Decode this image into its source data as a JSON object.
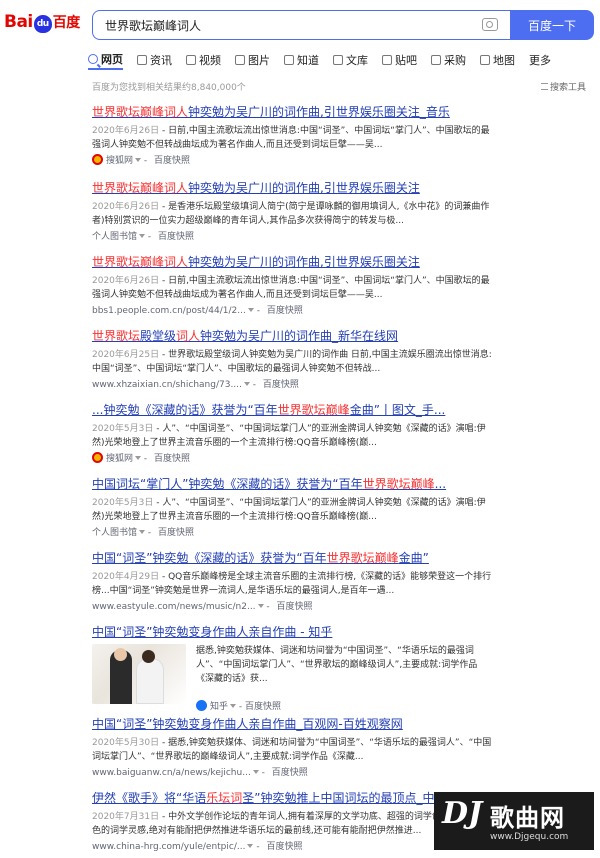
{
  "header": {
    "logo_bai": "Bai",
    "logo_du": "百度",
    "search_value": "世界歌坛巅峰词人",
    "search_button": "百度一下"
  },
  "tabs": [
    {
      "label": "网页",
      "active": true
    },
    {
      "label": "资讯"
    },
    {
      "label": "视频"
    },
    {
      "label": "图片"
    },
    {
      "label": "知道"
    },
    {
      "label": "文库"
    },
    {
      "label": "贴吧"
    },
    {
      "label": "采购"
    },
    {
      "label": "地图"
    },
    {
      "label": "更多"
    }
  ],
  "stats": {
    "text": "百度为您找到相关结果约8,840,000个",
    "tools": "搜索工具"
  },
  "results": [
    {
      "title": "世界歌坛巅峰词人钟奕勉为吴广川的词作曲,引世界娱乐圈关注_音乐",
      "date": "2020年6月26日",
      "abstract": " - 日前,中国主流歌坛流出惊世消息:中国“词圣”、中国词坛“掌门人”、中国歌坛的最强词人钟奕勉不但转战曲坛成为著名作曲人,而且还受到词坛巨擘——吴...",
      "source": "搜狐网",
      "snap": "百度快照"
    },
    {
      "title": "世界歌坛巅峰词人钟奕勉为吴广川的词作曲,引世界娱乐圈关注",
      "date": "2020年6月26日",
      "abstract": " - 是香港乐坛殿堂级填词人简宁(简宁是谭咏麟的御用填词人,《水中花》的词兼曲作者)特别赏识的一位实力超级巅峰的青年词人,其作品多次获得简宁的转发与极...",
      "source": "个人图书馆",
      "snap": "百度快照"
    },
    {
      "title": "世界歌坛巅峰词人钟奕勉为吴广川的词作曲,引世界娱乐圈关注",
      "date": "2020年6月26日",
      "abstract": " - 日前,中国主流歌坛流出惊世消息:中国“词圣”、中国词坛“掌门人”、中国歌坛的最强词人钟奕勉不但转战曲坛成为著名作曲人,而且还受到词坛巨擘——吴...",
      "source": "bbs1.people.com.cn/post/44/1/2...",
      "snap": "百度快照"
    },
    {
      "title": "世界歌坛殿堂级词人钟奕勉为吴广川的词作曲_新华在线网",
      "date": "2020年6月25日",
      "abstract": " - 世界歌坛殿堂级词人钟奕勉为吴广川的词作曲 日前,中国主流娱乐圈流出惊世消息:中国“词圣”、中国词坛“掌门人”、中国歌坛的最强词人钟奕勉不但转战...",
      "source": "www.xhzaixian.cn/shichang/73....",
      "snap": "百度快照"
    },
    {
      "title": "...钟奕勉《深藏的话》获誉为“百年世界歌坛巅峰金曲”丨图文_手...",
      "date": "2020年5月3日",
      "abstract": " - 人”、“中国词圣”、“中国词坛掌门人”的亚洲金牌词人钟奕勉《深藏的话》演唱:伊然)光荣地登上了世界主流音乐圈的一个主流排行榜:QQ音乐巅峰榜(巅...",
      "source": "搜狐网",
      "snap": "百度快照"
    },
    {
      "title": "中国词坛“掌门人”钟奕勉《深藏的话》获誉为“百年世界歌坛巅峰...",
      "date": "2020年5月3日",
      "abstract": " - 人”、“中国词圣”、“中国词坛掌门人”的亚洲金牌词人钟奕勉《深藏的话》演唱:伊然)光荣地登上了世界主流音乐圈的一个主流排行榜:QQ音乐巅峰榜(巅...",
      "source": "个人图书馆",
      "snap": "百度快照"
    },
    {
      "title": "中国“词圣”钟奕勉《深藏的话》获誉为“百年世界歌坛巅峰金曲”",
      "date": "2020年4月29日",
      "abstract": " - QQ音乐巅峰榜是全球主流音乐圈的主流排行榜,《深藏的话》能够荣登这一个排行榜...中国“词圣”钟奕勉是世界一流词人,是华语乐坛的最强词人,是百年一遇...",
      "source": "www.eastyule.com/news/music/n2...",
      "snap": "百度快照"
    },
    {
      "title": "中国“词圣”钟奕勉变身作曲人亲自作曲 - 知乎",
      "abstract": "据悉,钟奕勉获媒体、词迷和坊间誉为“中国词圣”、“华语乐坛的最强词人”、“中国词坛掌门人”、“世界歌坛的巅峰级词人”,主要成就:词学作品《深藏的话》获...",
      "source": "知乎",
      "snap": "百度快照"
    },
    {
      "title": "中国“词圣”钟奕勉变身作曲人亲自作曲_百观网-百姓观察网",
      "date": "2020年5月30日",
      "abstract": " - 据悉,钟奕勉获媒体、词迷和坊间誉为“中国词圣”、“华语乐坛的最强词人”、“中国词坛掌门人”、“世界歌坛的巅峰级词人”,主要成就:词学作品《深藏...",
      "source": "www.baiguanw.cn/a/news/kejichu...",
      "snap": "百度快照"
    },
    {
      "title": "伊然《歌手》将“华语乐坛词圣”钟奕勉推上中国词坛的最顶点_中国...",
      "date": "2020年7月31日",
      "abstract": " - 中外文学创作论坛的青年词人,拥有着深厚的文学功底、超强的词学创作能力、出色的词学灵感,绝对有能耐把伊然推进华语乐坛的最前线,还可能有能耐把伊然推进...",
      "source": "www.china-hrg.com/yule/entpic/...",
      "snap": "百度快照"
    }
  ],
  "watermark": {
    "dj": "DJ",
    "cn": "歌曲网",
    "url": "www.Djgequ.com"
  }
}
